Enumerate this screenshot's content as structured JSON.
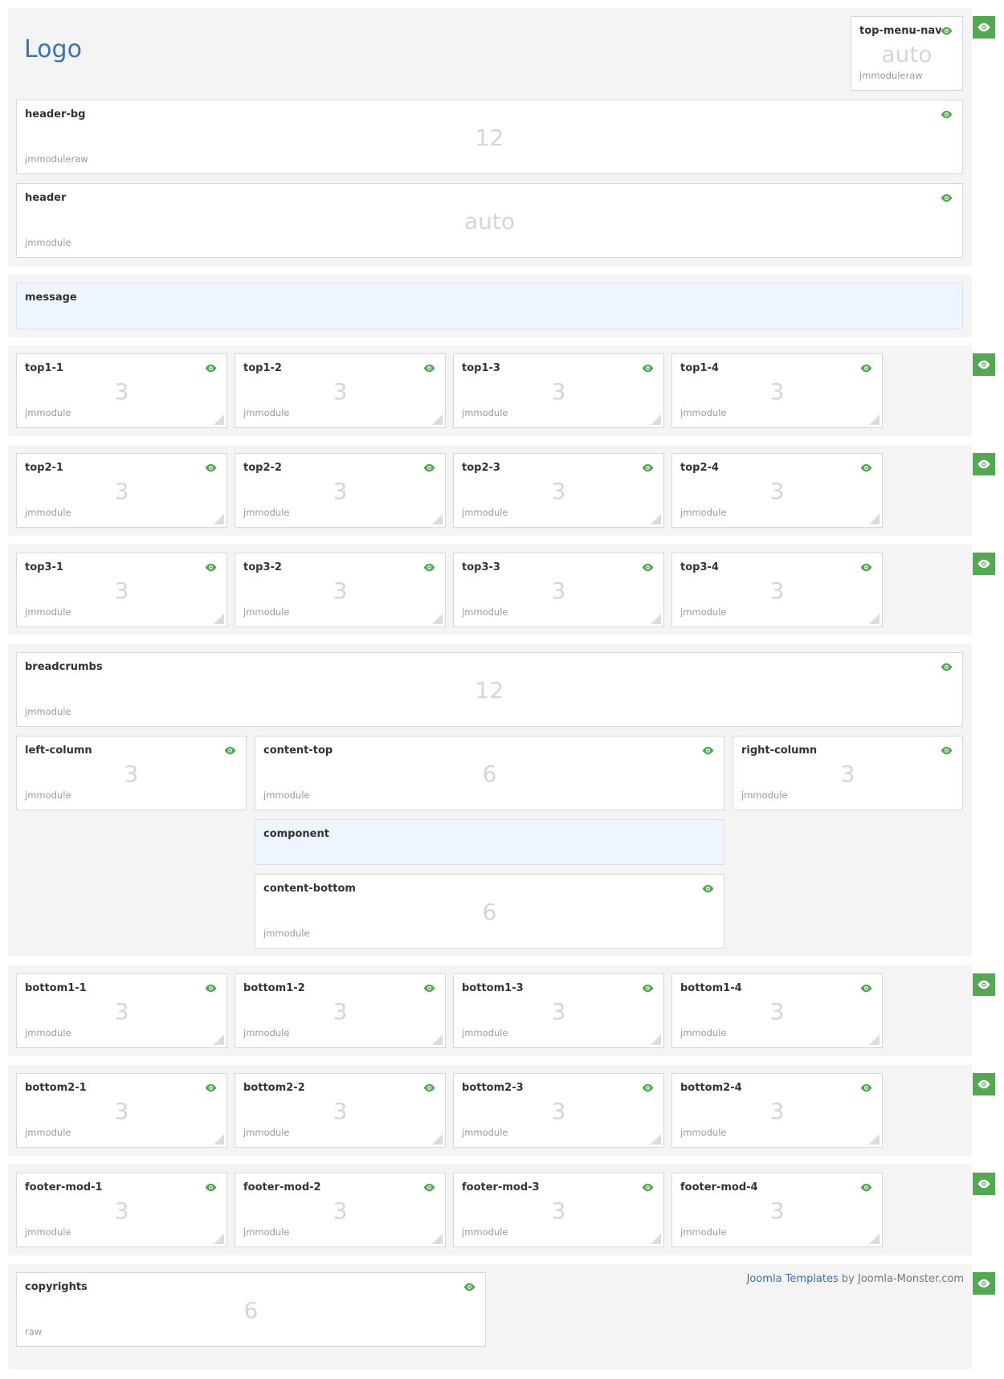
{
  "logo": "Logo",
  "colors": {
    "eye": "#55a754",
    "link": "#3a72b3",
    "section_bg": "#f4f4f4",
    "highlight_bg": "#eef5ff"
  },
  "icons": {
    "eye": "eye-icon",
    "resize": "resize-handle-icon"
  },
  "header": {
    "top_menu_nav": {
      "name": "top-menu-nav",
      "size": "auto",
      "type": "jmmoduleraw"
    },
    "header_bg": {
      "name": "header-bg",
      "size": "12",
      "type": "jmmoduleraw"
    },
    "header": {
      "name": "header",
      "size": "auto",
      "type": "jmmodule"
    }
  },
  "message": {
    "name": "message"
  },
  "rows": {
    "top1": [
      {
        "name": "top1-1",
        "size": "3",
        "type": "jmmodule"
      },
      {
        "name": "top1-2",
        "size": "3",
        "type": "jmmodule"
      },
      {
        "name": "top1-3",
        "size": "3",
        "type": "jmmodule"
      },
      {
        "name": "top1-4",
        "size": "3",
        "type": "jmmodule"
      }
    ],
    "top2": [
      {
        "name": "top2-1",
        "size": "3",
        "type": "jmmodule"
      },
      {
        "name": "top2-2",
        "size": "3",
        "type": "jmmodule"
      },
      {
        "name": "top2-3",
        "size": "3",
        "type": "jmmodule"
      },
      {
        "name": "top2-4",
        "size": "3",
        "type": "jmmodule"
      }
    ],
    "top3": [
      {
        "name": "top3-1",
        "size": "3",
        "type": "jmmodule"
      },
      {
        "name": "top3-2",
        "size": "3",
        "type": "jmmodule"
      },
      {
        "name": "top3-3",
        "size": "3",
        "type": "jmmodule"
      },
      {
        "name": "top3-4",
        "size": "3",
        "type": "jmmodule"
      }
    ],
    "bottom1": [
      {
        "name": "bottom1-1",
        "size": "3",
        "type": "jmmodule"
      },
      {
        "name": "bottom1-2",
        "size": "3",
        "type": "jmmodule"
      },
      {
        "name": "bottom1-3",
        "size": "3",
        "type": "jmmodule"
      },
      {
        "name": "bottom1-4",
        "size": "3",
        "type": "jmmodule"
      }
    ],
    "bottom2": [
      {
        "name": "bottom2-1",
        "size": "3",
        "type": "jmmodule"
      },
      {
        "name": "bottom2-2",
        "size": "3",
        "type": "jmmodule"
      },
      {
        "name": "bottom2-3",
        "size": "3",
        "type": "jmmodule"
      },
      {
        "name": "bottom2-4",
        "size": "3",
        "type": "jmmodule"
      }
    ],
    "footer": [
      {
        "name": "footer-mod-1",
        "size": "3",
        "type": "jmmodule"
      },
      {
        "name": "footer-mod-2",
        "size": "3",
        "type": "jmmodule"
      },
      {
        "name": "footer-mod-3",
        "size": "3",
        "type": "jmmodule"
      },
      {
        "name": "footer-mod-4",
        "size": "3",
        "type": "jmmodule"
      }
    ]
  },
  "main": {
    "breadcrumbs": {
      "name": "breadcrumbs",
      "size": "12",
      "type": "jmmodule"
    },
    "left_column": {
      "name": "left-column",
      "size": "3",
      "type": "jmmodule"
    },
    "content_top": {
      "name": "content-top",
      "size": "6",
      "type": "jmmodule"
    },
    "right_column": {
      "name": "right-column",
      "size": "3",
      "type": "jmmodule"
    },
    "component": {
      "name": "component"
    },
    "content_bottom": {
      "name": "content-bottom",
      "size": "6",
      "type": "jmmodule"
    }
  },
  "copyrights": {
    "name": "copyrights",
    "size": "6",
    "type": "raw"
  },
  "credit": {
    "link": "Joomla Templates",
    "by": " by Joomla-Monster.com"
  }
}
